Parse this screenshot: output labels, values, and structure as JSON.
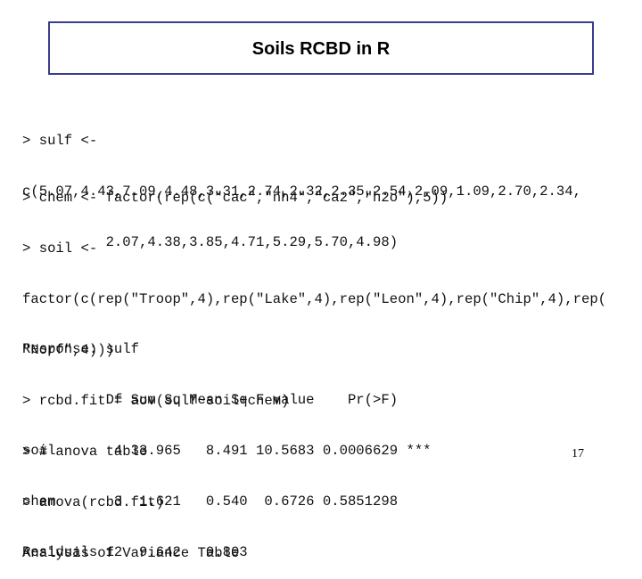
{
  "slide": {
    "title": "Soils RCBD in R",
    "page_number": "17"
  },
  "code": {
    "block1": [
      "> sulf <-",
      "c(5.07,4.43,7.09,4.48,3.31,2.74,2.32,2.35,2.54,2.09,1.09,2.70,2.34,",
      "          2.07,4.38,3.85,4.71,5.29,5.70,4.98)"
    ],
    "block2": [
      "> chem <- factor(rep(c(\"cac\",\"nh4\",\"ca2\",\"h2o\"),5))",
      "> soil <-",
      "factor(c(rep(\"Troop\",4),rep(\"Lake\",4),rep(\"Leon\",4),rep(\"Chip\",4),rep(",
      "\"Norf\",4)))",
      "> rcbd.fit = aov(sulf~soil+chem)",
      "> # anova table",
      "> anova(rcbd.fit)",
      "Analysis of Variance Table"
    ],
    "block3": [
      "Response: sulf",
      "          Df Sum Sq Mean Sq F value    Pr(>F)",
      "soil       4 33.965   8.491 10.5683 0.0006629 ***",
      "chem       3  1.621   0.540  0.6726 0.5851298",
      "Residuals 12  9.642   0.803"
    ]
  },
  "anova_table": {
    "response": "sulf",
    "columns": [
      "",
      "Df",
      "Sum Sq",
      "Mean Sq",
      "F value",
      "Pr(>F)",
      ""
    ],
    "rows": [
      {
        "term": "soil",
        "df": "4",
        "sum_sq": "33.965",
        "mean_sq": "8.491",
        "f_value": "10.5683",
        "p_value": "0.0006629",
        "signif": "***"
      },
      {
        "term": "chem",
        "df": "3",
        "sum_sq": "1.621",
        "mean_sq": "0.540",
        "f_value": "0.6726",
        "p_value": "0.5851298",
        "signif": ""
      },
      {
        "term": "Residuals",
        "df": "12",
        "sum_sq": "9.642",
        "mean_sq": "0.803",
        "f_value": "",
        "p_value": "",
        "signif": ""
      }
    ]
  },
  "colors": {
    "title_border": "#3c3c8c",
    "text": "#000000",
    "background": "#ffffff"
  }
}
